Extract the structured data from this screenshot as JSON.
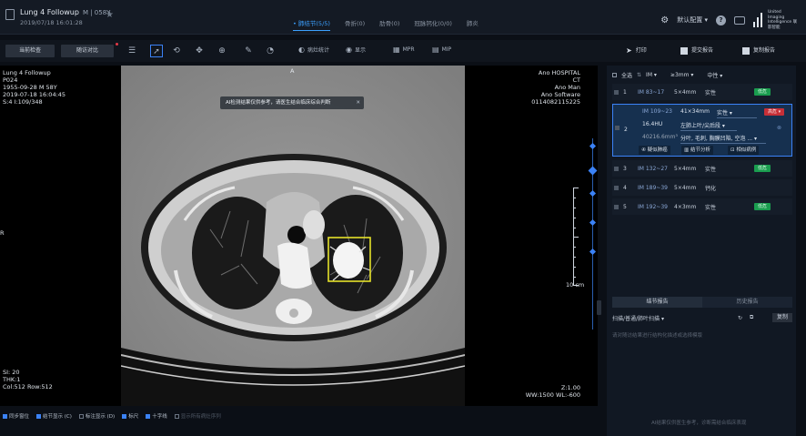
{
  "topbar": {
    "case_title": "Lung 4 Followup",
    "case_meta": "M | 058Y",
    "case_date": "2019/07/18 16:01:28",
    "tabs": [
      "• 肺结节(5/5)",
      "骨折(0)",
      "肋骨(0)",
      "冠脉钙化(0/0)",
      "肺炎"
    ],
    "active_tab_index": 0,
    "layout_dropdown": "默认配置 ▾",
    "help_symbol": "?",
    "logo_text": "United Imaging Intelligence 联影智能"
  },
  "toolbar": {
    "current_exam": "当前检查",
    "previous_exam": "随访对比",
    "tools": [
      "☰",
      "➚",
      "⟲",
      "✥",
      "⊕",
      "✎",
      "◔"
    ],
    "selected_tool_index": 1,
    "labels": [
      "病灶统计",
      "显示",
      "MPR",
      "MIP"
    ],
    "right_buttons": [
      "打印",
      "提交报告",
      "复制报告"
    ]
  },
  "viewer": {
    "top_left": [
      "Lung 4 Followup",
      "P024",
      "1955-09-28 M 58Y",
      "2019-07-18 16:04:45",
      "S:4 I:109/348"
    ],
    "top_center": "A",
    "top_right": [
      "Ano HOSPITAL",
      "CT",
      "Ano Man",
      "Ano Software",
      "0114082115225"
    ],
    "left_marker": "R",
    "bottom_left": [
      "SI: 20",
      "THK:1",
      "Col:512 Row:512"
    ],
    "bottom_right": [
      "Z:1.00",
      "WW:1500 WL:-600"
    ],
    "scale_label": "10 cm",
    "notice": "AI检测结果仅供参考，请医生结合临床综合判断",
    "notice_close": "✕"
  },
  "bottombar": {
    "checkboxes": [
      {
        "label": "同步窗位",
        "checked": true
      },
      {
        "label": "结节显示 (C)",
        "checked": true
      },
      {
        "label": "标注显示 (D)",
        "checked": false
      },
      {
        "label": "标尺",
        "checked": true
      },
      {
        "label": "十字线",
        "checked": true
      },
      {
        "label": "显示所有病灶序列",
        "checked": false
      }
    ]
  },
  "panel": {
    "header": {
      "select_all": "全选",
      "filter1": "IM ▾",
      "filter2": "≥3mm ▾",
      "filter3": "中性 ▾"
    },
    "rows": [
      {
        "num": "1",
        "im": "IM 83~17",
        "size": "5×4mm",
        "type": "实性",
        "badge": "低危",
        "badge_color": "green"
      },
      {
        "num": "3",
        "im": "IM 132~27",
        "size": "5×4mm",
        "type": "实性",
        "badge": "低危",
        "badge_color": "green"
      },
      {
        "num": "4",
        "im": "IM 189~39",
        "size": "5×4mm",
        "type": "钙化",
        "badge": "",
        "badge_color": ""
      },
      {
        "num": "5",
        "im": "IM 192~39",
        "size": "4×3mm",
        "type": "实性",
        "badge": "低危",
        "badge_color": "green"
      }
    ],
    "expanded": {
      "num": "2",
      "im": "IM 109~23",
      "size": "41×34mm",
      "type": "实性 ▾",
      "badge": "高危 ▾",
      "hu": "16.4HU",
      "location": "左肺上叶/尖后段 ▾",
      "volume": "40216.6mm³",
      "features": "分叶, 毛刺, 胸膜凹陷, 空泡 ... ▾",
      "actions": [
        "④ 疑似肺癌",
        "▥ 结节分析",
        "⊡ 相似病例"
      ]
    },
    "tabs": [
      "结节报告",
      "历史报告"
    ],
    "active_tab_index": 0,
    "filter_dropdown": "扫描/普通/肺叶扫描 ▾",
    "report_button": "复制",
    "placeholder": "请对随访结果进行结构化描述或选择模版",
    "footer": "AI结果仅供医生参考，诊断需结合临床表现"
  }
}
